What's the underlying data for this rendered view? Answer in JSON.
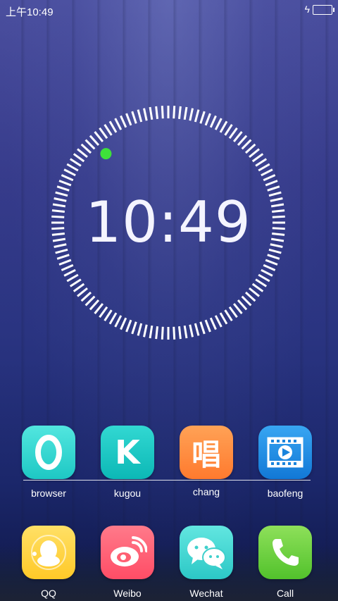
{
  "status_bar": {
    "time": "上午10:49",
    "charging_icon": "bolt-icon",
    "battery_icon": "battery-icon"
  },
  "clock": {
    "time": "10:49",
    "seconds_dot_color": "#3ee03a"
  },
  "apps_row1": [
    {
      "label": "browser",
      "icon": "browser-icon",
      "glyph": "O",
      "color": "#2ed6d0"
    },
    {
      "label": "kugou",
      "icon": "kugou-icon",
      "glyph": "K",
      "color": "#12c4c2"
    },
    {
      "label": "chang",
      "icon": "chang-icon",
      "glyph": "唱",
      "color": "#ff8a3c"
    },
    {
      "label": "baofeng",
      "icon": "baofeng-icon",
      "glyph": "▶",
      "color": "#1e8fe6"
    }
  ],
  "apps_dock": [
    {
      "label": "QQ",
      "icon": "qq-icon",
      "color": "#ffd23e"
    },
    {
      "label": "Weibo",
      "icon": "weibo-icon",
      "color": "#ff5f72"
    },
    {
      "label": "Wechat",
      "icon": "wechat-icon",
      "color": "#3fd8d0"
    },
    {
      "label": "Call",
      "icon": "phone-icon",
      "color": "#69d23c"
    }
  ]
}
